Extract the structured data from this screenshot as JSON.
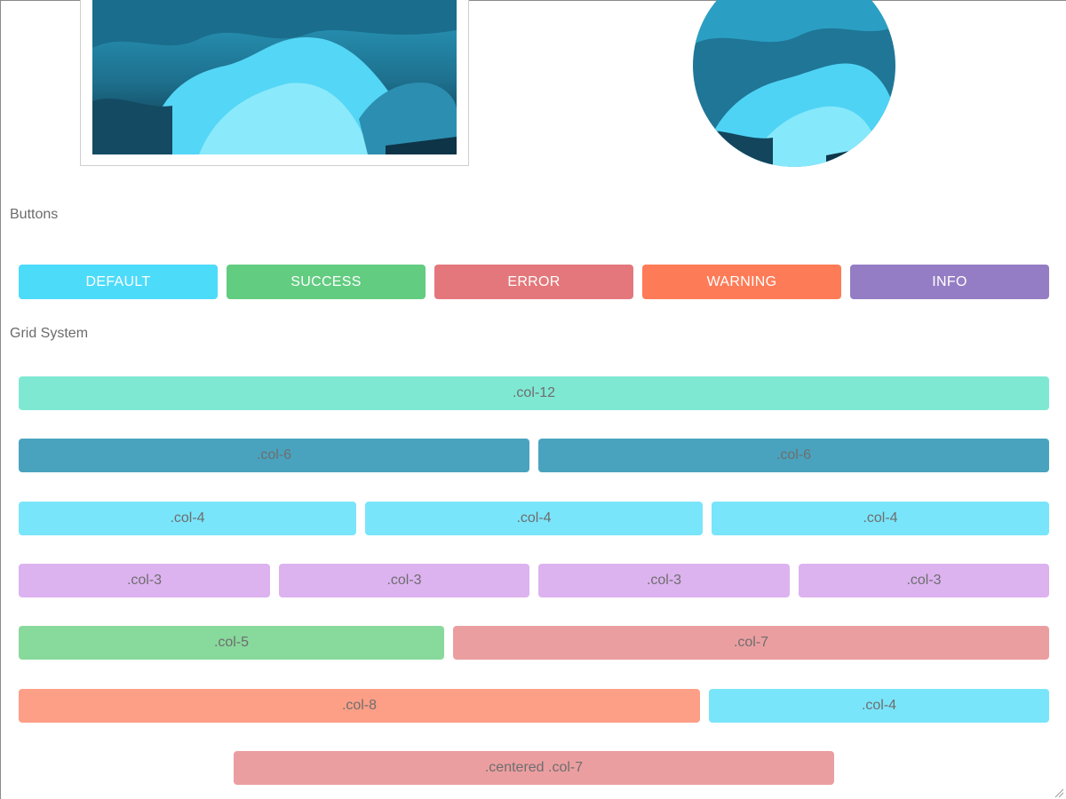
{
  "sections": {
    "buttons_title": "Buttons",
    "grid_title": "Grid System"
  },
  "buttons": [
    {
      "label": "DEFAULT",
      "color": "#4ddbfa"
    },
    {
      "label": "SUCCESS",
      "color": "#62cc80"
    },
    {
      "label": "ERROR",
      "color": "#e4777b"
    },
    {
      "label": "WARNING",
      "color": "#fe7b57"
    },
    {
      "label": "INFO",
      "color": "#947dc4"
    }
  ],
  "grid": {
    "row1": [
      {
        "label": ".col-12",
        "color": "#7fe8d3"
      }
    ],
    "row2": [
      {
        "label": ".col-6",
        "color": "#4aa3be"
      },
      {
        "label": ".col-6",
        "color": "#4aa3be"
      }
    ],
    "row3": [
      {
        "label": ".col-4",
        "color": "#79e5fa"
      },
      {
        "label": ".col-4",
        "color": "#79e5fa"
      },
      {
        "label": ".col-4",
        "color": "#79e5fa"
      }
    ],
    "row4": [
      {
        "label": ".col-3",
        "color": "#dcb2ef"
      },
      {
        "label": ".col-3",
        "color": "#dcb2ef"
      },
      {
        "label": ".col-3",
        "color": "#dcb2ef"
      },
      {
        "label": ".col-3",
        "color": "#dcb2ef"
      }
    ],
    "row5": [
      {
        "label": ".col-5",
        "color": "#88d99c"
      },
      {
        "label": ".col-7",
        "color": "#eb9ea0"
      }
    ],
    "row6": [
      {
        "label": ".col-8",
        "color": "#fc9f86"
      },
      {
        "label": ".col-4",
        "color": "#79e5fa"
      }
    ],
    "row7": [
      {
        "label": ".centered .col-7",
        "color": "#eb9ea0"
      }
    ]
  },
  "icons": {
    "resize_grip": "resize-grip-icon"
  }
}
